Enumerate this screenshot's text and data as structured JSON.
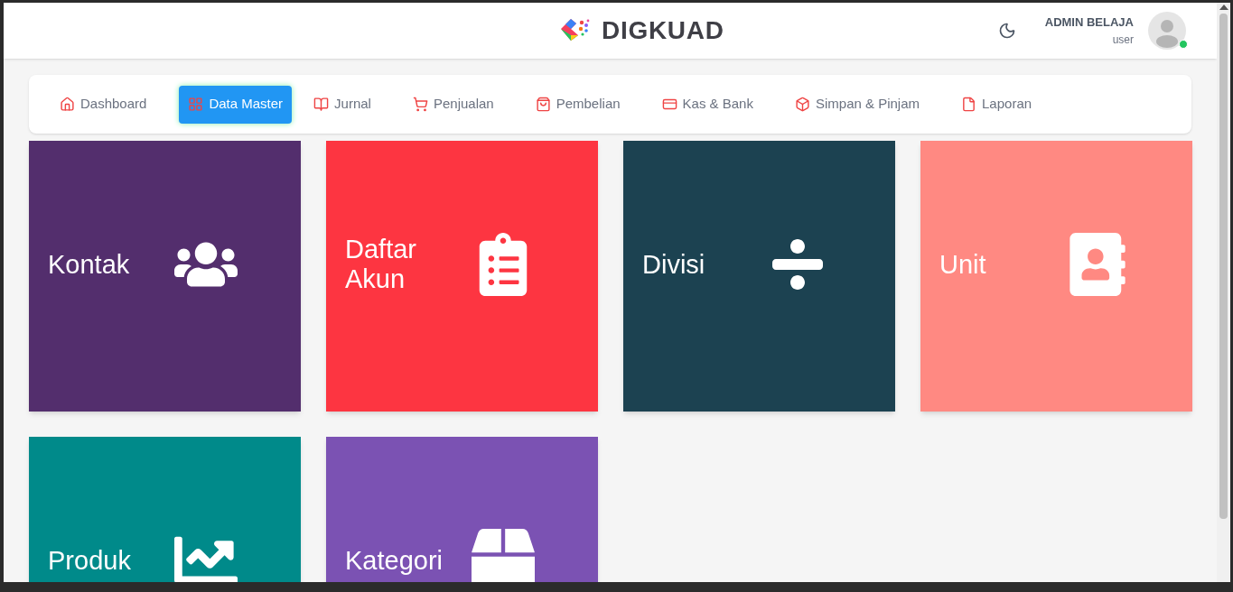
{
  "header": {
    "brand": "DIGKUAD",
    "user": {
      "name": "ADMIN BELAJA",
      "role": "user",
      "online": true
    }
  },
  "nav": [
    {
      "label": "Dashboard",
      "selected": false
    },
    {
      "label": "Data Master",
      "selected": true
    },
    {
      "label": "Jurnal",
      "selected": false
    },
    {
      "label": "Penjualan",
      "selected": false
    },
    {
      "label": "Pembelian",
      "selected": false
    },
    {
      "label": "Kas & Bank",
      "selected": false
    },
    {
      "label": "Simpan & Pinjam",
      "selected": false
    },
    {
      "label": "Laporan",
      "selected": false
    }
  ],
  "tiles": [
    {
      "label": "Kontak",
      "color": "#532e6d"
    },
    {
      "label": "Daftar Akun",
      "color": "#fd3541"
    },
    {
      "label": "Divisi",
      "color": "#1c4251"
    },
    {
      "label": "Unit",
      "color": "#ff8982"
    },
    {
      "label": "Produk",
      "color": "#008a8a"
    },
    {
      "label": "Kategori",
      "color": "#7b52b3"
    }
  ]
}
